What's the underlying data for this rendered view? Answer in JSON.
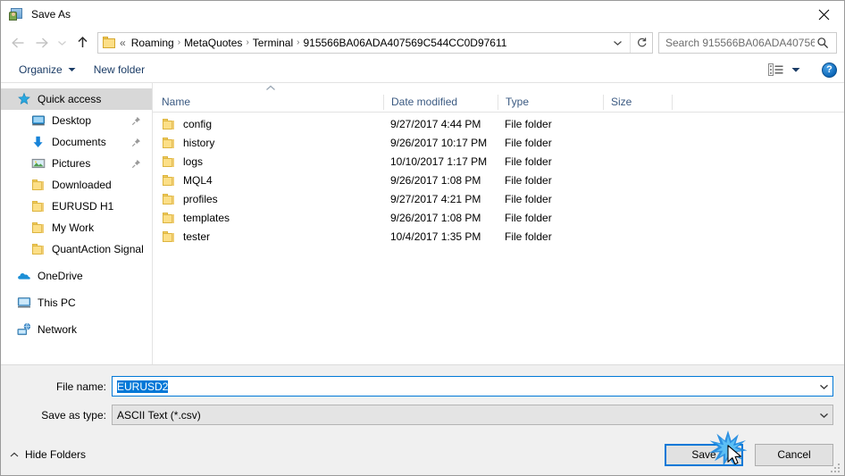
{
  "window": {
    "title": "Save As",
    "icon": "save-as-icon",
    "close_label": "✕"
  },
  "nav": {
    "back": "back-arrow",
    "forward": "forward-arrow",
    "recent": "recent-locations-chevron",
    "up": "up-arrow",
    "breadcrumb": {
      "prefix": "«",
      "items": [
        "Roaming",
        "MetaQuotes",
        "Terminal",
        "915566BA06ADA407569C544CC0D97611"
      ],
      "separator": "›"
    },
    "refresh": "refresh-icon",
    "search": {
      "placeholder": "Search 915566BA06ADA40756...",
      "icon": "search-icon"
    }
  },
  "toolbar": {
    "organize_label": "Organize",
    "new_folder_label": "New folder",
    "view_icon": "view-layout-icon",
    "help_label": "?"
  },
  "sidebar": {
    "items": [
      {
        "label": "Quick access",
        "icon": "star-icon",
        "level": 1,
        "selected": true,
        "pinned": false
      },
      {
        "label": "Desktop",
        "icon": "desktop-icon",
        "level": 2,
        "selected": false,
        "pinned": true
      },
      {
        "label": "Documents",
        "icon": "documents-download-icon",
        "level": 2,
        "selected": false,
        "pinned": true
      },
      {
        "label": "Pictures",
        "icon": "pictures-icon",
        "level": 2,
        "selected": false,
        "pinned": true
      },
      {
        "label": "Downloaded",
        "icon": "folder-icon",
        "level": 2,
        "selected": false,
        "pinned": false
      },
      {
        "label": "EURUSD H1",
        "icon": "folder-icon",
        "level": 2,
        "selected": false,
        "pinned": false
      },
      {
        "label": "My Work",
        "icon": "folder-icon",
        "level": 2,
        "selected": false,
        "pinned": false
      },
      {
        "label": "QuantAction Signal",
        "icon": "folder-icon",
        "level": 2,
        "selected": false,
        "pinned": false
      },
      {
        "label": "OneDrive",
        "icon": "onedrive-cloud-icon",
        "level": 1,
        "selected": false,
        "pinned": false,
        "group": true
      },
      {
        "label": "This PC",
        "icon": "this-pc-icon",
        "level": 1,
        "selected": false,
        "pinned": false,
        "group": true
      },
      {
        "label": "Network",
        "icon": "network-icon",
        "level": 1,
        "selected": false,
        "pinned": false,
        "group": true
      }
    ]
  },
  "filelist": {
    "sort_column": "Name",
    "sort_direction": "ascending",
    "columns": [
      {
        "label": "Name",
        "key": "name"
      },
      {
        "label": "Date modified",
        "key": "date"
      },
      {
        "label": "Type",
        "key": "type"
      },
      {
        "label": "Size",
        "key": "size"
      }
    ],
    "rows": [
      {
        "name": "config",
        "date": "9/27/2017 4:44 PM",
        "type": "File folder",
        "size": "",
        "icon": "folder-icon"
      },
      {
        "name": "history",
        "date": "9/26/2017 10:17 PM",
        "type": "File folder",
        "size": "",
        "icon": "folder-icon"
      },
      {
        "name": "logs",
        "date": "10/10/2017 1:17 PM",
        "type": "File folder",
        "size": "",
        "icon": "folder-icon"
      },
      {
        "name": "MQL4",
        "date": "9/26/2017 1:08 PM",
        "type": "File folder",
        "size": "",
        "icon": "folder-icon"
      },
      {
        "name": "profiles",
        "date": "9/27/2017 4:21 PM",
        "type": "File folder",
        "size": "",
        "icon": "folder-icon"
      },
      {
        "name": "templates",
        "date": "9/26/2017 1:08 PM",
        "type": "File folder",
        "size": "",
        "icon": "folder-icon"
      },
      {
        "name": "tester",
        "date": "10/4/2017 1:35 PM",
        "type": "File folder",
        "size": "",
        "icon": "folder-icon"
      }
    ]
  },
  "fields": {
    "filename_label": "File name:",
    "filename_value": "EURUSD2",
    "filetype_label": "Save as type:",
    "filetype_value": "ASCII Text (*.csv)"
  },
  "footer": {
    "hide_folders_label": "Hide Folders",
    "save_label": "Save",
    "cancel_label": "Cancel"
  },
  "colors": {
    "accent": "#0078d7",
    "folder_yellow": "#fcdf87",
    "selection_gray": "#d8d8d8",
    "panel_gray": "#f0f0f0",
    "column_header_text": "#3b5a82",
    "toolbar_text": "#1b3c66"
  }
}
